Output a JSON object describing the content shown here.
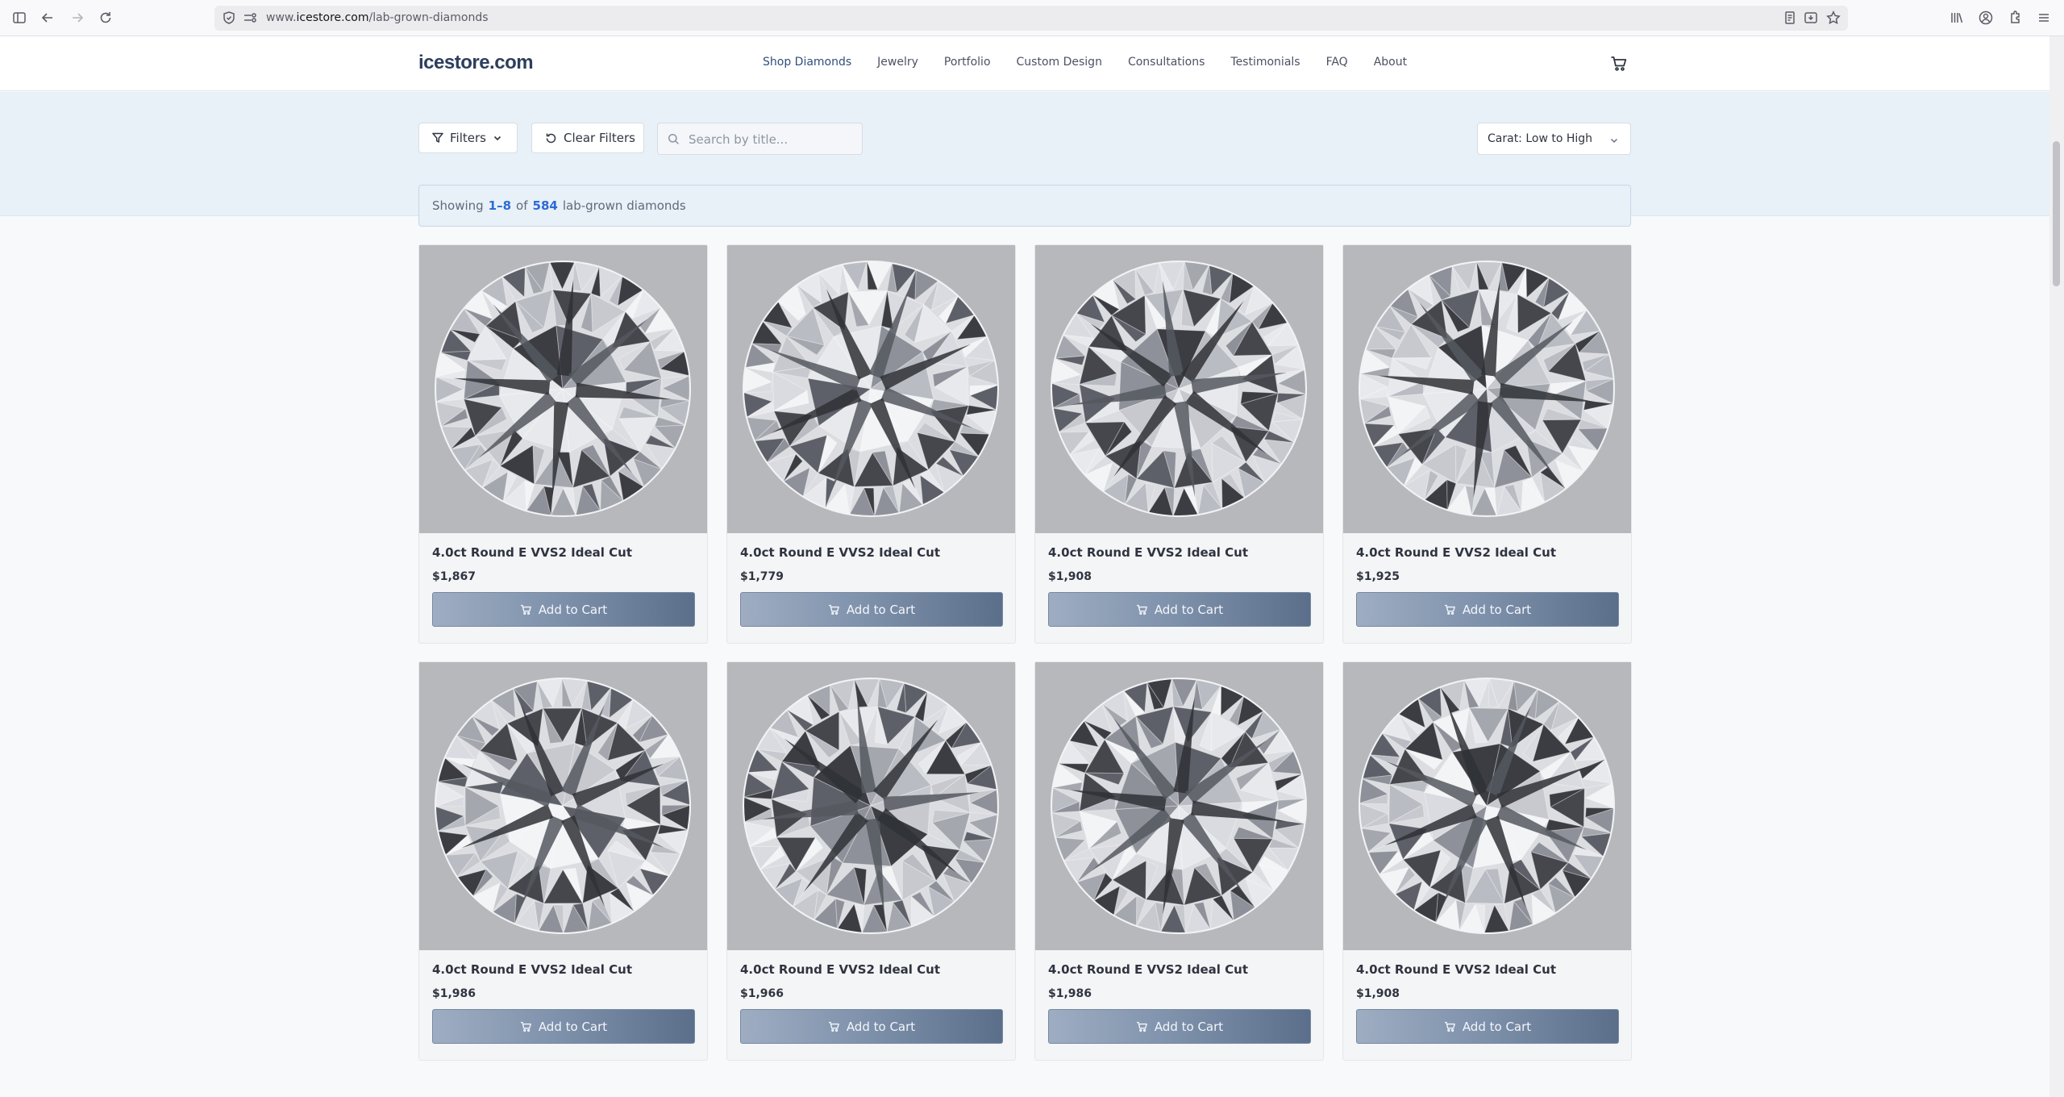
{
  "browser": {
    "url_prefix": "www.",
    "url_host": "icestore.com",
    "url_path": "/lab-grown-diamonds"
  },
  "header": {
    "logo": "icestore.com",
    "nav": [
      {
        "label": "Shop Diamonds",
        "active": true
      },
      {
        "label": "Jewelry"
      },
      {
        "label": "Portfolio"
      },
      {
        "label": "Custom Design"
      },
      {
        "label": "Consultations"
      },
      {
        "label": "Testimonials"
      },
      {
        "label": "FAQ"
      },
      {
        "label": "About"
      }
    ]
  },
  "filters": {
    "filters_label": "Filters",
    "clear_label": "Clear Filters",
    "search_placeholder": "Search by title...",
    "sort_value": "Carat: Low to High"
  },
  "results": {
    "prefix": "Showing",
    "range": "1–8",
    "of": "of",
    "total": "584",
    "suffix": "lab-grown diamonds"
  },
  "products": [
    {
      "title": "4.0ct Round E VVS2 Ideal Cut",
      "price": "$1,867",
      "button": "Add to Cart"
    },
    {
      "title": "4.0ct Round E VVS2 Ideal Cut",
      "price": "$1,779",
      "button": "Add to Cart"
    },
    {
      "title": "4.0ct Round E VVS2 Ideal Cut",
      "price": "$1,908",
      "button": "Add to Cart"
    },
    {
      "title": "4.0ct Round E VVS2 Ideal Cut",
      "price": "$1,925",
      "button": "Add to Cart"
    },
    {
      "title": "4.0ct Round E VVS2 Ideal Cut",
      "price": "$1,986",
      "button": "Add to Cart"
    },
    {
      "title": "4.0ct Round E VVS2 Ideal Cut",
      "price": "$1,966",
      "button": "Add to Cart"
    },
    {
      "title": "4.0ct Round E VVS2 Ideal Cut",
      "price": "$1,986",
      "button": "Add to Cart"
    },
    {
      "title": "4.0ct Round E VVS2 Ideal Cut",
      "price": "$1,908",
      "button": "Add to Cart"
    }
  ]
}
